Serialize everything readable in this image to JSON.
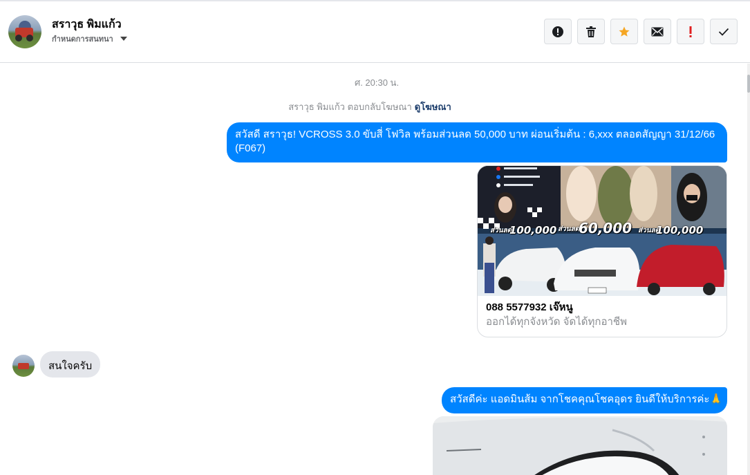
{
  "header": {
    "contact_name": "สราวุธ พิมแก้ว",
    "manage_label": "กำหนดการสนทนา",
    "actions": [
      {
        "name": "report-button",
        "icon": "exclamation-circle-icon"
      },
      {
        "name": "delete-button",
        "icon": "trash-icon"
      },
      {
        "name": "star-button",
        "icon": "star-icon",
        "color": "#f5a623"
      },
      {
        "name": "mark-unread-button",
        "icon": "envelope-icon"
      },
      {
        "name": "mark-important-button",
        "icon": "exclamation-icon",
        "color": "#e02020"
      },
      {
        "name": "mark-done-button",
        "icon": "checkmark-icon"
      }
    ]
  },
  "chat": {
    "timestamp": "ศ. 20:30 น.",
    "ad_reply_text": "สราวุธ พิมแก้ว ตอบกลับโฆษณา",
    "ad_reply_link": "ดูโฆษณา",
    "message_1": "สวัสดี สราวุธ! VCROSS 3.0 ขับสี่ โฟวิล พร้อมส่วนลด 50,000 บาท ผ่อนเริ่มต้น : 6,xxx ตลอดสัญญา 31/12/66 (F067)",
    "ad_card": {
      "title": "088 5577932 เจ๊หนู",
      "subtitle": "ออกได้ทุกจังหวัด จัดได้ทุกอาชีพ",
      "image_text": {
        "discount_left": "100,000",
        "discount_center": "60,000",
        "discount_right": "100,000",
        "discount_prefix": "ส่วนลด"
      }
    },
    "incoming_message": "สนใจครับ",
    "message_2": "สวัสดีค่ะ แอดมินส้ม จากโชคคุณโชคอุดร ยินดีให้บริการค่ะ🙏"
  },
  "colors": {
    "outgoing_bubble": "#0084ff",
    "incoming_bubble": "#e4e6eb",
    "link": "#1c3d6b"
  }
}
